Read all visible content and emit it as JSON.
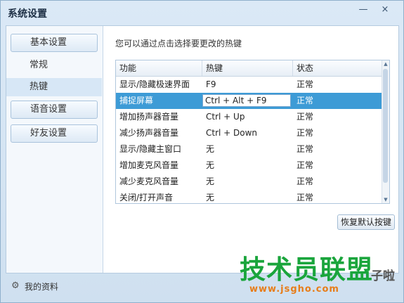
{
  "window": {
    "title": "系统设置",
    "minimize_glyph": "—",
    "close_glyph": "×"
  },
  "sidebar": {
    "basic_settings": "基本设置",
    "general": "常规",
    "hotkeys": "热键",
    "voice_settings": "语音设置",
    "friend_settings": "好友设置"
  },
  "main": {
    "hint": "您可以通过点击选择要更改的热键",
    "restore_button": "恢复默认按键"
  },
  "table": {
    "headers": [
      "功能",
      "热键",
      "状态"
    ],
    "rows": [
      {
        "function": "显示/隐藏极速界面",
        "hotkey": "F9",
        "status": "正常"
      },
      {
        "function": "捕捉屏幕",
        "hotkey": "Ctrl + Alt + F9",
        "status": "正常"
      },
      {
        "function": "增加扬声器音量",
        "hotkey": "Ctrl + Up",
        "status": "正常"
      },
      {
        "function": "减少扬声器音量",
        "hotkey": "Ctrl + Down",
        "status": "正常"
      },
      {
        "function": "显示/隐藏主窗口",
        "hotkey": "无",
        "status": "正常"
      },
      {
        "function": "增加麦克风音量",
        "hotkey": "无",
        "status": "正常"
      },
      {
        "function": "减少麦克风音量",
        "hotkey": "无",
        "status": "正常"
      },
      {
        "function": "关闭/打开声音",
        "hotkey": "无",
        "status": "正常"
      }
    ],
    "selected_row": 1
  },
  "footer": {
    "profile_label": "我的资料",
    "profile_icon": "gear-icon"
  },
  "watermark": {
    "logo_text": "技术员联盟",
    "extra": "子啦",
    "url": "www.jsgho.com"
  },
  "colors": {
    "selection": "#3d9bd6",
    "accent_border": "#8fb0cc",
    "watermark_green": "#1aa53c"
  }
}
